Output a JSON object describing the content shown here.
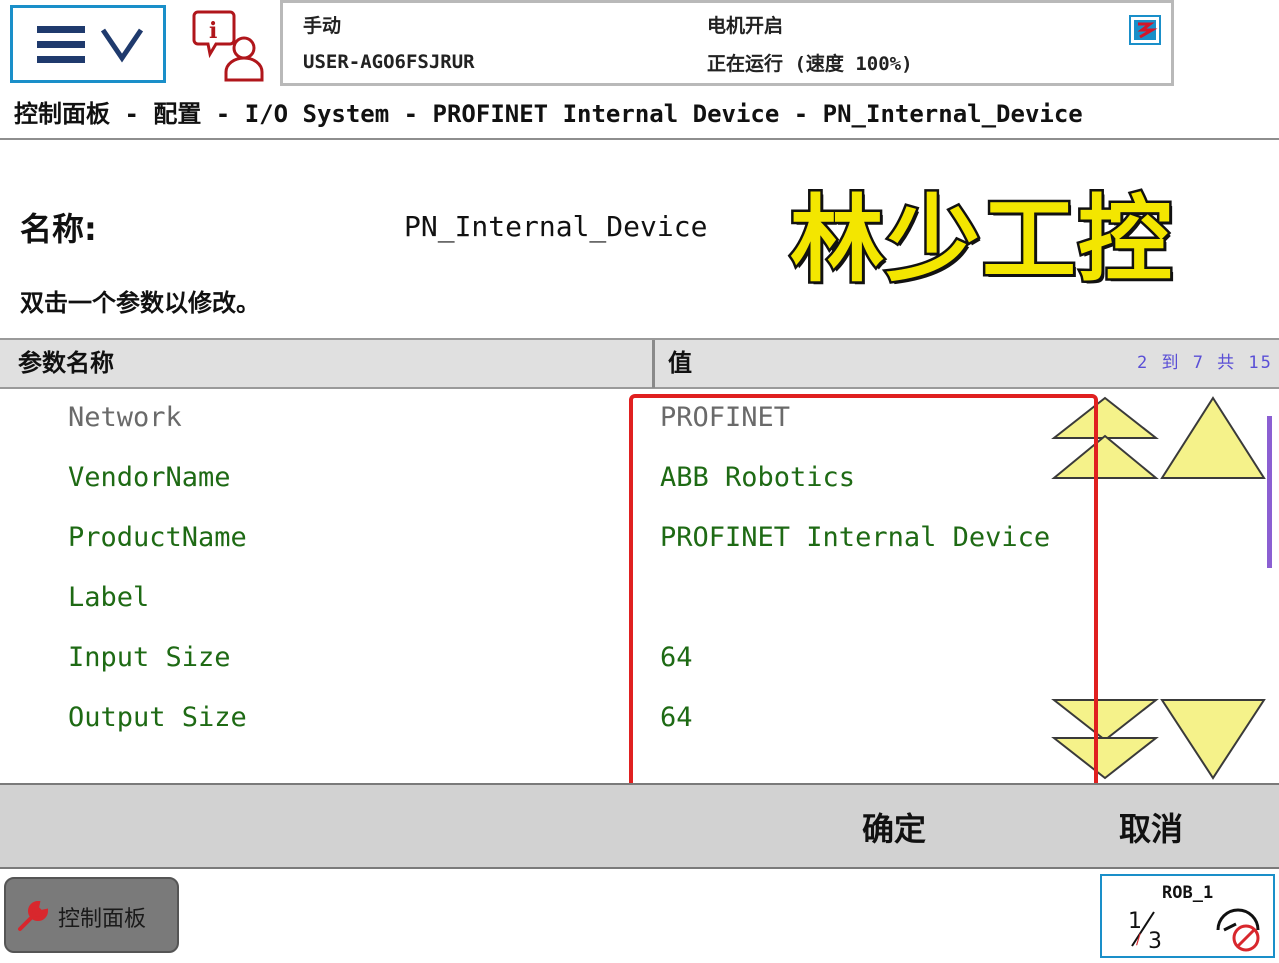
{
  "status": {
    "mode": "手动",
    "controller": "USER-AGO6FSJRUR",
    "motor_state": "电机开启",
    "run_state": "正在运行 (速度 100%)"
  },
  "breadcrumb": "控制面板 - 配置 - I/O System - PROFINET Internal Device - PN_Internal_Device",
  "name_label": "名称:",
  "name_value": "PN_Internal_Device",
  "watermark": "林少工控",
  "hint": "双击一个参数以修改。",
  "table": {
    "col_param": "参数名称",
    "col_value": "值",
    "pager": "2 到 7 共 15",
    "rows": [
      {
        "name": "Network",
        "value": "PROFINET",
        "disabled": true
      },
      {
        "name": "VendorName",
        "value": "ABB Robotics"
      },
      {
        "name": "ProductName",
        "value": "PROFINET Internal Device"
      },
      {
        "name": "Label",
        "value": ""
      },
      {
        "name": "Input Size",
        "value": "64"
      },
      {
        "name": "Output Size",
        "value": "64"
      }
    ]
  },
  "buttons": {
    "ok": "确定",
    "cancel": "取消"
  },
  "taskbar": {
    "control_panel": "控制面板",
    "robot": "ROB_1",
    "speed_fraction": "1/3"
  },
  "colors": {
    "accent_blue": "#1a8fc9",
    "value_green": "#1e6a14",
    "highlight_red": "#e02020",
    "arrow_yellow": "#f5f28a"
  },
  "icons": [
    "menu-icon",
    "chevron-down-icon",
    "info-user-icon",
    "status-flag-icon",
    "wrench-icon",
    "scroll-up-icon",
    "page-up-icon",
    "scroll-down-icon",
    "page-down-icon",
    "speed-fraction-icon",
    "robot-mode-icon"
  ]
}
